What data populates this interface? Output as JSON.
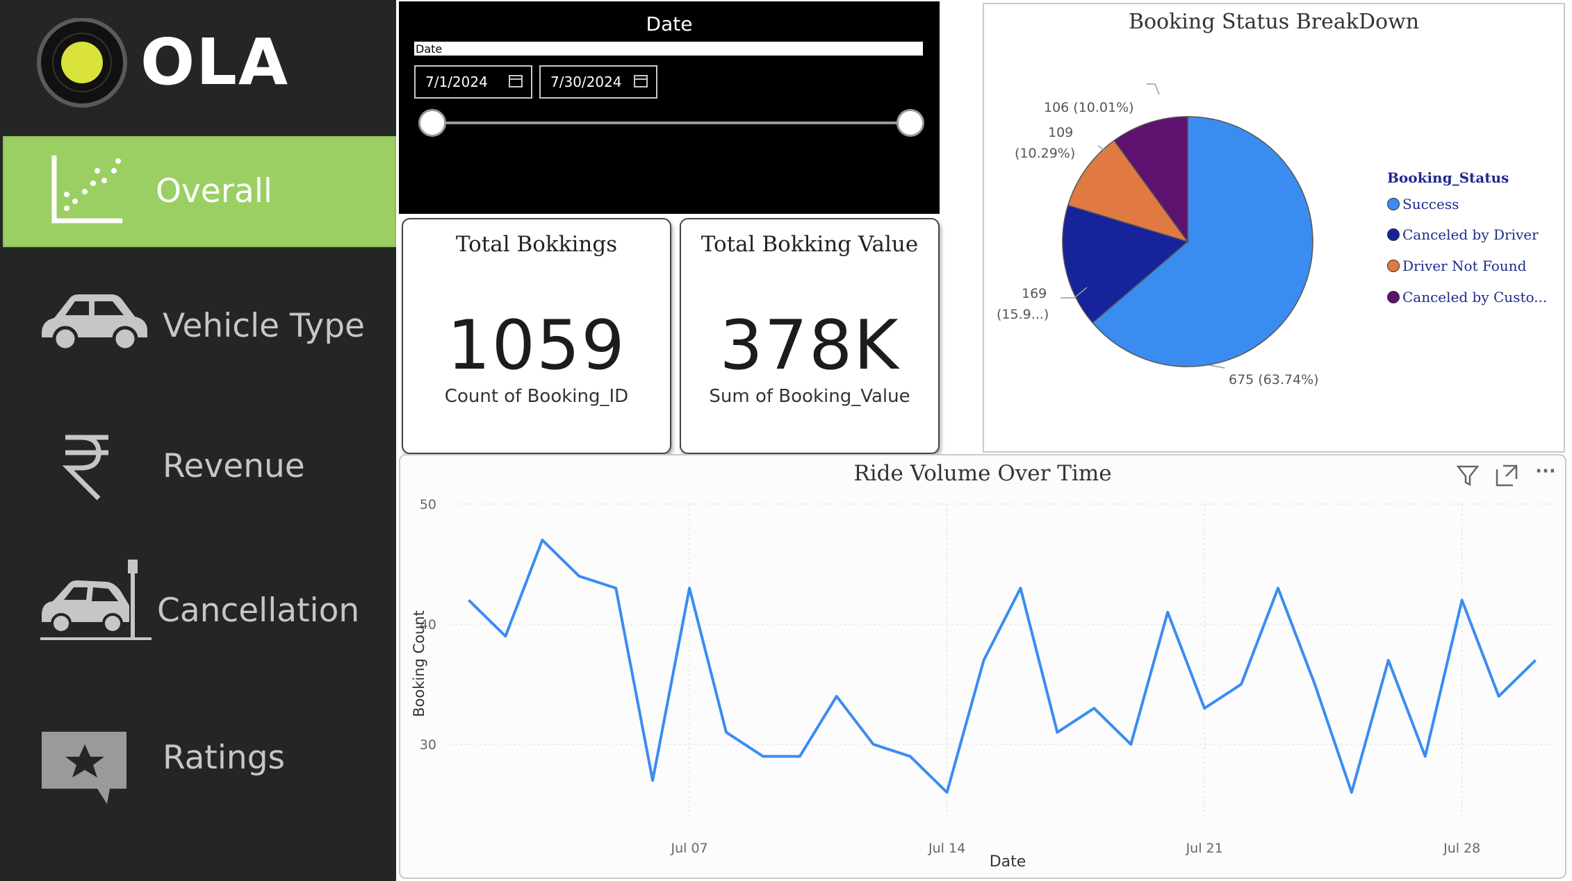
{
  "brand": {
    "name": "OLA",
    "logo_dot_color": "#d9e33c"
  },
  "sidebar": {
    "items": [
      {
        "label": "Overall",
        "icon": "scatter-chart-icon",
        "active": true
      },
      {
        "label": "Vehicle Type",
        "icon": "car-icon",
        "active": false
      },
      {
        "label": "Revenue",
        "icon": "rupee-icon",
        "active": false
      },
      {
        "label": "Cancellation",
        "icon": "car-crash-icon",
        "active": false
      },
      {
        "label": "Ratings",
        "icon": "star-comment-icon",
        "active": false
      }
    ],
    "active_color": "#9bcf63"
  },
  "date_slicer": {
    "title": "Date",
    "field_label": "Date",
    "start": "7/1/2024",
    "end": "7/30/2024"
  },
  "cards": [
    {
      "title": "Total Bokkings",
      "value": "1059",
      "subtitle": "Count of Booking_ID"
    },
    {
      "title": "Total Bokking Value",
      "value": "378K",
      "subtitle": "Sum of Booking_Value"
    }
  ],
  "pie_chart": {
    "title": "Booking Status BreakDown",
    "legend_title": "Booking_Status",
    "legend_labels": [
      "Success",
      "Canceled by Driver",
      "Driver Not Found",
      "Canceled by Custo..."
    ],
    "slice_labels": [
      "675 (63.74%)",
      "169",
      "(15.9...)",
      "109",
      "(10.29%)",
      "106 (10.01%)"
    ]
  },
  "line_chart": {
    "title": "Ride Volume Over Time",
    "tools": [
      "filter-icon",
      "focus-mode-icon",
      "more-options-icon"
    ]
  },
  "chart_data": [
    {
      "type": "pie",
      "title": "Booking Status BreakDown",
      "legend_title": "Booking_Status",
      "legend": "right",
      "slices": [
        {
          "name": "Success",
          "value": 675,
          "percent": 63.74,
          "color": "#3b8cf0"
        },
        {
          "name": "Canceled by Driver",
          "value": 169,
          "percent": 15.9,
          "color": "#17239a"
        },
        {
          "name": "Driver Not Found",
          "value": 109,
          "percent": 10.29,
          "color": "#e07a42"
        },
        {
          "name": "Canceled by Customer",
          "value": 106,
          "percent": 10.01,
          "color": "#5e1270"
        }
      ]
    },
    {
      "type": "line",
      "title": "Ride Volume Over Time",
      "xlabel": "Date",
      "ylabel": "Booking Count",
      "ylim": [
        24,
        50
      ],
      "y_ticks": [
        30,
        40,
        50
      ],
      "x_tick_labels": [
        "Jul 07",
        "Jul 14",
        "Jul 21",
        "Jul 28"
      ],
      "x_tick_days": [
        7,
        14,
        21,
        28
      ],
      "grid": true,
      "color": "#3b8cf0",
      "x": [
        1,
        2,
        3,
        4,
        5,
        6,
        7,
        8,
        9,
        10,
        11,
        12,
        13,
        14,
        15,
        16,
        17,
        18,
        19,
        20,
        21,
        22,
        23,
        24,
        25,
        26,
        27,
        28,
        29,
        30
      ],
      "values": [
        42,
        39,
        47,
        44,
        43,
        27,
        43,
        31,
        29,
        29,
        34,
        30,
        29,
        26,
        37,
        43,
        31,
        33,
        30,
        41,
        33,
        35,
        43,
        35,
        26,
        37,
        29,
        42,
        34,
        37
      ]
    }
  ]
}
